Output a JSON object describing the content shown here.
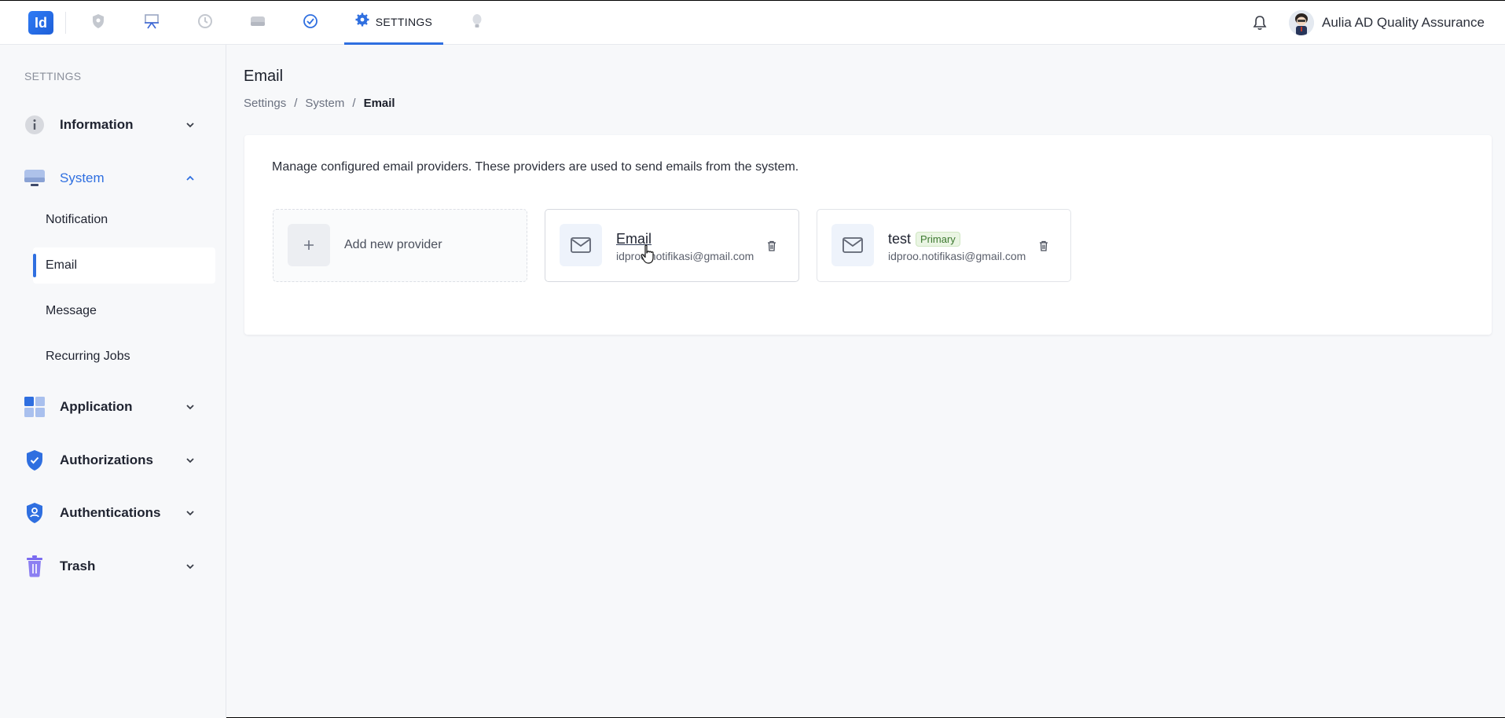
{
  "topbar": {
    "logo_text": "Id",
    "tabs": [
      {
        "icon": "shield-icon"
      },
      {
        "icon": "presentation-icon"
      },
      {
        "icon": "history-icon"
      },
      {
        "icon": "drive-icon"
      },
      {
        "icon": "check-circle-icon"
      },
      {
        "icon": "gear-icon",
        "label": "SETTINGS",
        "active": true
      },
      {
        "icon": "lightbulb-icon"
      }
    ],
    "user_name": "Aulia AD Quality Assurance"
  },
  "sidebar": {
    "heading": "SETTINGS",
    "items": [
      {
        "label": "Information",
        "icon": "info-icon"
      },
      {
        "label": "System",
        "icon": "monitor-icon",
        "expanded": true,
        "children": [
          {
            "label": "Notification"
          },
          {
            "label": "Email",
            "selected": true
          },
          {
            "label": "Message"
          },
          {
            "label": "Recurring Jobs"
          }
        ]
      },
      {
        "label": "Application",
        "icon": "apps-grid-icon"
      },
      {
        "label": "Authorizations",
        "icon": "shield-check-icon"
      },
      {
        "label": "Authentications",
        "icon": "shield-user-icon"
      },
      {
        "label": "Trash",
        "icon": "trash-icon"
      }
    ]
  },
  "main": {
    "title": "Email",
    "breadcrumb": [
      "Settings",
      "System",
      "Email"
    ],
    "description": "Manage configured email providers. These providers are used to send emails from the system.",
    "add_provider_label": "Add new provider",
    "providers": [
      {
        "name": "Email",
        "email": "idproo.notifikasi@gmail.com",
        "badge": ""
      },
      {
        "name": "test",
        "email": "idproo.notifikasi@gmail.com",
        "badge": "Primary"
      }
    ]
  },
  "colors": {
    "accent": "#2f6fe0",
    "background": "#f7f8fa",
    "badge_green": "#3e7a32"
  }
}
